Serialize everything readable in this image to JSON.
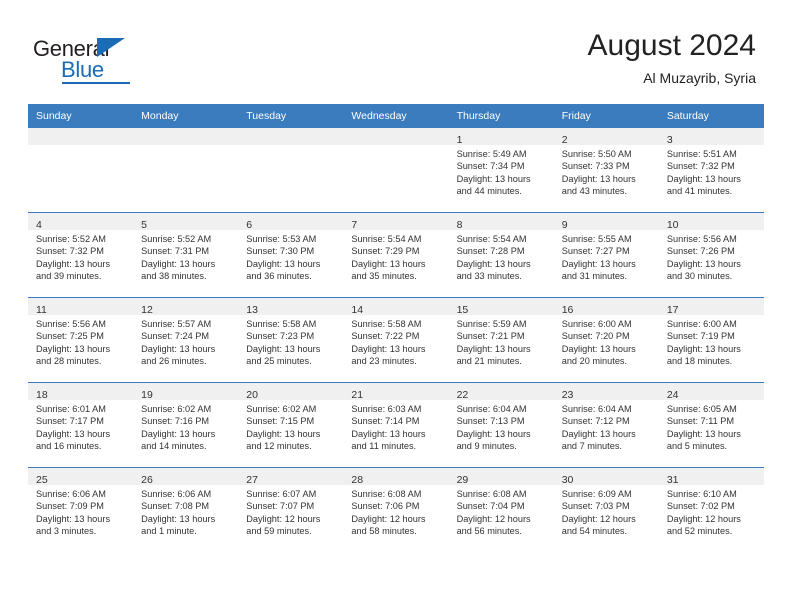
{
  "brand": {
    "name_part1": "General",
    "name_part2": "Blue",
    "accent_color": "#1b6cb5"
  },
  "header": {
    "title": "August 2024",
    "subtitle": "Al Muzayrib, Syria"
  },
  "theme": {
    "header_row_bg": "#3a7cbe",
    "day_band_bg": "#f0f0f0",
    "text": "#333333"
  },
  "weekday_headers": [
    "Sunday",
    "Monday",
    "Tuesday",
    "Wednesday",
    "Thursday",
    "Friday",
    "Saturday"
  ],
  "weeks": [
    [
      {
        "day": "",
        "sunrise": "",
        "sunset": "",
        "daylight": ""
      },
      {
        "day": "",
        "sunrise": "",
        "sunset": "",
        "daylight": ""
      },
      {
        "day": "",
        "sunrise": "",
        "sunset": "",
        "daylight": ""
      },
      {
        "day": "",
        "sunrise": "",
        "sunset": "",
        "daylight": ""
      },
      {
        "day": "1",
        "sunrise": "Sunrise: 5:49 AM",
        "sunset": "Sunset: 7:34 PM",
        "daylight": "Daylight: 13 hours and 44 minutes."
      },
      {
        "day": "2",
        "sunrise": "Sunrise: 5:50 AM",
        "sunset": "Sunset: 7:33 PM",
        "daylight": "Daylight: 13 hours and 43 minutes."
      },
      {
        "day": "3",
        "sunrise": "Sunrise: 5:51 AM",
        "sunset": "Sunset: 7:32 PM",
        "daylight": "Daylight: 13 hours and 41 minutes."
      }
    ],
    [
      {
        "day": "4",
        "sunrise": "Sunrise: 5:52 AM",
        "sunset": "Sunset: 7:32 PM",
        "daylight": "Daylight: 13 hours and 39 minutes."
      },
      {
        "day": "5",
        "sunrise": "Sunrise: 5:52 AM",
        "sunset": "Sunset: 7:31 PM",
        "daylight": "Daylight: 13 hours and 38 minutes."
      },
      {
        "day": "6",
        "sunrise": "Sunrise: 5:53 AM",
        "sunset": "Sunset: 7:30 PM",
        "daylight": "Daylight: 13 hours and 36 minutes."
      },
      {
        "day": "7",
        "sunrise": "Sunrise: 5:54 AM",
        "sunset": "Sunset: 7:29 PM",
        "daylight": "Daylight: 13 hours and 35 minutes."
      },
      {
        "day": "8",
        "sunrise": "Sunrise: 5:54 AM",
        "sunset": "Sunset: 7:28 PM",
        "daylight": "Daylight: 13 hours and 33 minutes."
      },
      {
        "day": "9",
        "sunrise": "Sunrise: 5:55 AM",
        "sunset": "Sunset: 7:27 PM",
        "daylight": "Daylight: 13 hours and 31 minutes."
      },
      {
        "day": "10",
        "sunrise": "Sunrise: 5:56 AM",
        "sunset": "Sunset: 7:26 PM",
        "daylight": "Daylight: 13 hours and 30 minutes."
      }
    ],
    [
      {
        "day": "11",
        "sunrise": "Sunrise: 5:56 AM",
        "sunset": "Sunset: 7:25 PM",
        "daylight": "Daylight: 13 hours and 28 minutes."
      },
      {
        "day": "12",
        "sunrise": "Sunrise: 5:57 AM",
        "sunset": "Sunset: 7:24 PM",
        "daylight": "Daylight: 13 hours and 26 minutes."
      },
      {
        "day": "13",
        "sunrise": "Sunrise: 5:58 AM",
        "sunset": "Sunset: 7:23 PM",
        "daylight": "Daylight: 13 hours and 25 minutes."
      },
      {
        "day": "14",
        "sunrise": "Sunrise: 5:58 AM",
        "sunset": "Sunset: 7:22 PM",
        "daylight": "Daylight: 13 hours and 23 minutes."
      },
      {
        "day": "15",
        "sunrise": "Sunrise: 5:59 AM",
        "sunset": "Sunset: 7:21 PM",
        "daylight": "Daylight: 13 hours and 21 minutes."
      },
      {
        "day": "16",
        "sunrise": "Sunrise: 6:00 AM",
        "sunset": "Sunset: 7:20 PM",
        "daylight": "Daylight: 13 hours and 20 minutes."
      },
      {
        "day": "17",
        "sunrise": "Sunrise: 6:00 AM",
        "sunset": "Sunset: 7:19 PM",
        "daylight": "Daylight: 13 hours and 18 minutes."
      }
    ],
    [
      {
        "day": "18",
        "sunrise": "Sunrise: 6:01 AM",
        "sunset": "Sunset: 7:17 PM",
        "daylight": "Daylight: 13 hours and 16 minutes."
      },
      {
        "day": "19",
        "sunrise": "Sunrise: 6:02 AM",
        "sunset": "Sunset: 7:16 PM",
        "daylight": "Daylight: 13 hours and 14 minutes."
      },
      {
        "day": "20",
        "sunrise": "Sunrise: 6:02 AM",
        "sunset": "Sunset: 7:15 PM",
        "daylight": "Daylight: 13 hours and 12 minutes."
      },
      {
        "day": "21",
        "sunrise": "Sunrise: 6:03 AM",
        "sunset": "Sunset: 7:14 PM",
        "daylight": "Daylight: 13 hours and 11 minutes."
      },
      {
        "day": "22",
        "sunrise": "Sunrise: 6:04 AM",
        "sunset": "Sunset: 7:13 PM",
        "daylight": "Daylight: 13 hours and 9 minutes."
      },
      {
        "day": "23",
        "sunrise": "Sunrise: 6:04 AM",
        "sunset": "Sunset: 7:12 PM",
        "daylight": "Daylight: 13 hours and 7 minutes."
      },
      {
        "day": "24",
        "sunrise": "Sunrise: 6:05 AM",
        "sunset": "Sunset: 7:11 PM",
        "daylight": "Daylight: 13 hours and 5 minutes."
      }
    ],
    [
      {
        "day": "25",
        "sunrise": "Sunrise: 6:06 AM",
        "sunset": "Sunset: 7:09 PM",
        "daylight": "Daylight: 13 hours and 3 minutes."
      },
      {
        "day": "26",
        "sunrise": "Sunrise: 6:06 AM",
        "sunset": "Sunset: 7:08 PM",
        "daylight": "Daylight: 13 hours and 1 minute."
      },
      {
        "day": "27",
        "sunrise": "Sunrise: 6:07 AM",
        "sunset": "Sunset: 7:07 PM",
        "daylight": "Daylight: 12 hours and 59 minutes."
      },
      {
        "day": "28",
        "sunrise": "Sunrise: 6:08 AM",
        "sunset": "Sunset: 7:06 PM",
        "daylight": "Daylight: 12 hours and 58 minutes."
      },
      {
        "day": "29",
        "sunrise": "Sunrise: 6:08 AM",
        "sunset": "Sunset: 7:04 PM",
        "daylight": "Daylight: 12 hours and 56 minutes."
      },
      {
        "day": "30",
        "sunrise": "Sunrise: 6:09 AM",
        "sunset": "Sunset: 7:03 PM",
        "daylight": "Daylight: 12 hours and 54 minutes."
      },
      {
        "day": "31",
        "sunrise": "Sunrise: 6:10 AM",
        "sunset": "Sunset: 7:02 PM",
        "daylight": "Daylight: 12 hours and 52 minutes."
      }
    ]
  ]
}
